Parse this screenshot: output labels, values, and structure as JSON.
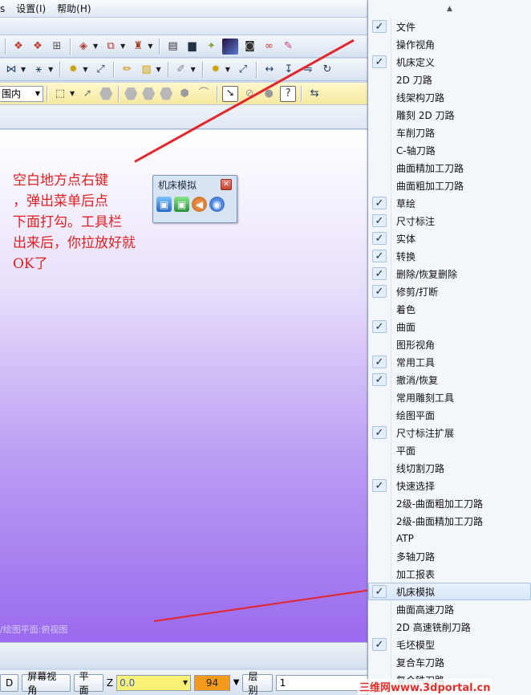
{
  "menubar": {
    "items": [
      "s",
      "设置(I)",
      "帮助(H)"
    ]
  },
  "toolbar": {
    "scope_select": "围内"
  },
  "viewport": {
    "annotation": "空白地方点右键\n，弹出菜单后点\n下面打勾。工具栏\n出来后，你拉放好就\nOK了",
    "status_label": "/绘图平面:俯视图"
  },
  "floating_toolbar": {
    "title": "机床模拟"
  },
  "bottombar": {
    "btn_d": "D",
    "screen_view": "屏幕视角",
    "plane": "平面",
    "z_label": "Z",
    "z_value": "0.0",
    "color_value": "94",
    "level_label": "层别",
    "level_value": "1"
  },
  "context_menu": {
    "items": [
      {
        "label": "文件",
        "checked": true
      },
      {
        "label": "操作视角",
        "checked": false
      },
      {
        "label": "机床定义",
        "checked": true
      },
      {
        "label": "2D 刀路",
        "checked": false
      },
      {
        "label": "线架构刀路",
        "checked": false
      },
      {
        "label": "雕刻 2D 刀路",
        "checked": false
      },
      {
        "label": "车削刀路",
        "checked": false
      },
      {
        "label": "C-轴刀路",
        "checked": false
      },
      {
        "label": "曲面精加工刀路",
        "checked": false
      },
      {
        "label": "曲面粗加工刀路",
        "checked": false
      },
      {
        "label": "草绘",
        "checked": true
      },
      {
        "label": "尺寸标注",
        "checked": true
      },
      {
        "label": "实体",
        "checked": true
      },
      {
        "label": "转换",
        "checked": true
      },
      {
        "label": "删除/恢复删除",
        "checked": true
      },
      {
        "label": "修剪/打断",
        "checked": true
      },
      {
        "label": "着色",
        "checked": false
      },
      {
        "label": "曲面",
        "checked": true
      },
      {
        "label": "图形视角",
        "checked": false
      },
      {
        "label": "常用工具",
        "checked": true
      },
      {
        "label": "撤消/恢复",
        "checked": true
      },
      {
        "label": "常用雕刻工具",
        "checked": false
      },
      {
        "label": "绘图平面",
        "checked": false
      },
      {
        "label": "尺寸标注扩展",
        "checked": true
      },
      {
        "label": "平面",
        "checked": false
      },
      {
        "label": "线切割刀路",
        "checked": false
      },
      {
        "label": "快速选择",
        "checked": true
      },
      {
        "label": "2级-曲面粗加工刀路",
        "checked": false
      },
      {
        "label": "2级-曲面精加工刀路",
        "checked": false
      },
      {
        "label": "ATP",
        "checked": false
      },
      {
        "label": "多轴刀路",
        "checked": false
      },
      {
        "label": "加工报表",
        "checked": false
      },
      {
        "label": "机床模拟",
        "checked": true,
        "highlighted": true
      },
      {
        "label": "曲面高速刀路",
        "checked": false
      },
      {
        "label": "2D 高速铣削刀路",
        "checked": false
      },
      {
        "label": "毛坯模型",
        "checked": true
      },
      {
        "label": "复合车刀路",
        "checked": false
      },
      {
        "label": "复合铣刀路",
        "checked": false
      }
    ]
  },
  "watermark": "三维网www.3dportal.cn",
  "colors": {
    "annotation": "#e02020",
    "z_field": "#f9f277",
    "color_field": "#f59a1b"
  }
}
